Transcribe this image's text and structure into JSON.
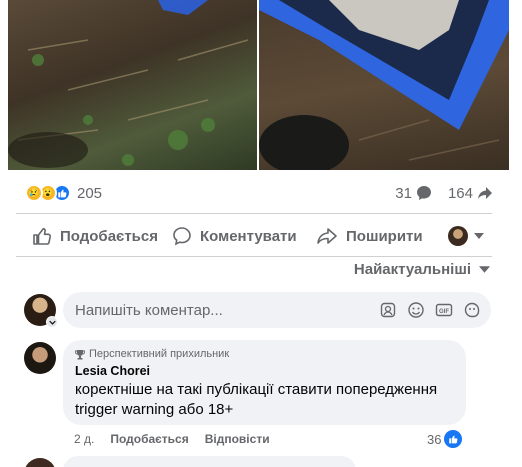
{
  "reactions": {
    "emojis": [
      "sad-emoji",
      "wow-emoji",
      "like-emoji"
    ],
    "count": "205",
    "comments_count": "31",
    "shares_count": "164"
  },
  "actions": {
    "like_label": "Подобається",
    "comment_label": "Коментувати",
    "share_label": "Поширити"
  },
  "sort": {
    "label": "Найактуальніші"
  },
  "composer": {
    "placeholder": "Напишіть коментар..."
  },
  "comment": {
    "badge": "Перспективний прихильник",
    "author": "Lesia Chorei",
    "text_line1": "коректніше на такі публікації ставити попередження",
    "text_line2": "trigger warning або 18+",
    "time": "2 д.",
    "like_label": "Подобається",
    "reply_label": "Відповісти",
    "reaction_count": "36"
  },
  "colors": {
    "brand": "#1877f2",
    "secondary_text": "#65676b",
    "bubble": "#f0f2f5"
  }
}
